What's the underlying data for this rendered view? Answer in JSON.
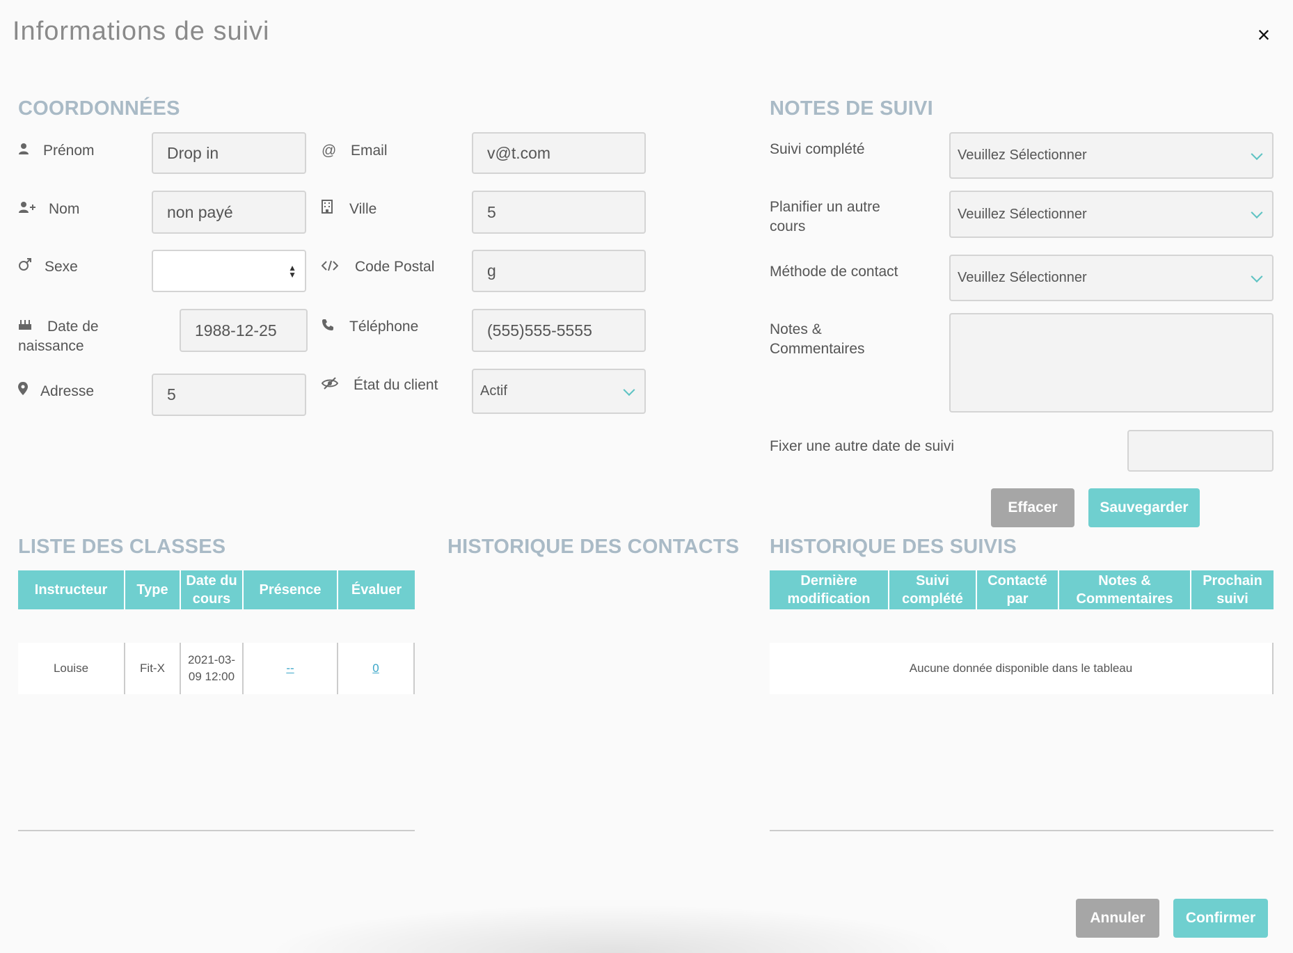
{
  "modal": {
    "title": "Informations de suivi",
    "close": "×"
  },
  "coord": {
    "title": "COORDONNÉES",
    "prenom": {
      "label": "Prénom",
      "value": "Drop in"
    },
    "nom": {
      "label": "Nom",
      "value": "non payé"
    },
    "sexe": {
      "label": "Sexe",
      "value": ""
    },
    "naissance": {
      "label1": "Date de",
      "label2": "naissance",
      "value": "1988-12-25"
    },
    "adresse": {
      "label": "Adresse",
      "value": "5"
    },
    "email": {
      "label": "Email",
      "value": "v@t.com"
    },
    "ville": {
      "label": "Ville",
      "value": "5"
    },
    "code_postal": {
      "label": "Code Postal",
      "value": "g"
    },
    "telephone": {
      "label": "Téléphone",
      "value": "(555)555-5555"
    },
    "etat": {
      "label": "État du client",
      "value": "Actif"
    }
  },
  "notes": {
    "title": "NOTES DE SUIVI",
    "suivi_complete": {
      "label": "Suivi complété",
      "value": "Veuillez Sélectionner"
    },
    "planifier": {
      "label1": "Planifier un autre",
      "label2": "cours",
      "value": "Veuillez Sélectionner"
    },
    "methode": {
      "label": "Méthode de contact",
      "value": "Veuillez Sélectionner"
    },
    "commentaires": {
      "label1": "Notes &",
      "label2": "Commentaires",
      "value": ""
    },
    "fixer_date": {
      "label": "Fixer une autre date de suivi",
      "value": ""
    },
    "effacer": "Effacer",
    "sauvegarder": "Sauvegarder"
  },
  "classes": {
    "title": "LISTE DES CLASSES",
    "headers": [
      "Instructeur",
      "Type",
      "Date du cours",
      "Présence",
      "Évaluer"
    ],
    "row": {
      "instructeur": "Louise",
      "type": "Fit-X",
      "date1": "2021-03-",
      "date2": "09 12:00",
      "presence": "--",
      "evaluer": "0"
    }
  },
  "contacts": {
    "title": "HISTORIQUE DES CONTACTS"
  },
  "suivis": {
    "title": "HISTORIQUE DES SUIVIS",
    "headers": [
      "Dernière modification",
      "Suivi complété",
      "Contacté par",
      "Notes & Commentaires",
      "Prochain suivi"
    ],
    "empty": "Aucune donnée disponible dans le tableau"
  },
  "footer": {
    "annuler": "Annuler",
    "confirmer": "Confirmer"
  },
  "colors": {
    "accent": "#6fcfcf",
    "section": "#a9bac6",
    "button_gray": "#a6a6a6"
  },
  "icons": {
    "prenom": "user-icon",
    "nom": "user-plus-icon",
    "sexe": "male-icon",
    "naissance": "birthday-cake-icon",
    "adresse": "map-marker-icon",
    "email": "at-icon",
    "ville": "building-icon",
    "code_postal": "code-icon",
    "telephone": "phone-icon",
    "etat": "eye-slash-icon"
  }
}
